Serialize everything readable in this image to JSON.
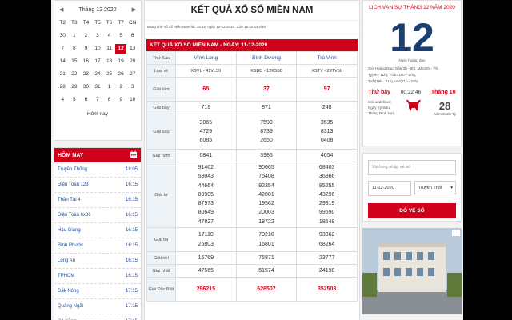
{
  "calendar": {
    "month_label": "Tháng 12 2020",
    "weekdays": [
      "T2",
      "T3",
      "T4",
      "T5",
      "T6",
      "T7",
      "CN"
    ],
    "days": [
      "30",
      "1",
      "2",
      "3",
      "4",
      "5",
      "6",
      "7",
      "8",
      "9",
      "10",
      "11",
      "12",
      "13",
      "14",
      "15",
      "16",
      "17",
      "18",
      "19",
      "20",
      "21",
      "22",
      "23",
      "24",
      "25",
      "26",
      "27",
      "28",
      "29",
      "30",
      "31",
      "1",
      "2",
      "3",
      "4",
      "5",
      "6",
      "7",
      "8",
      "9",
      "10"
    ],
    "selected_day": "12",
    "today_label": "Hôm nay"
  },
  "schedule": {
    "title": "HÔM NAY",
    "rows": [
      {
        "name": "Truyền Thống",
        "time": "18:05"
      },
      {
        "name": "Điện Toán 123",
        "time": "16:15"
      },
      {
        "name": "Thần Tài 4",
        "time": "16:15"
      },
      {
        "name": "Điện Toán 6x36",
        "time": "16:15"
      },
      {
        "name": "Hậu Giang",
        "time": "16:15"
      },
      {
        "name": "Bình Phước",
        "time": "16:15"
      },
      {
        "name": "Long An",
        "time": "16:15"
      },
      {
        "name": "TPHCM",
        "time": "16:15"
      },
      {
        "name": "Đắk Nông",
        "time": "17:15"
      },
      {
        "name": "Quảng Ngãi",
        "time": "17:15"
      },
      {
        "name": "Đà Nẵng",
        "time": "17:15"
      }
    ]
  },
  "results": {
    "page_title": "KẾT QUẢ XỔ SỐ MIỀN NAM",
    "subtitle": "Đang chờ xổ số Miền Nam lúc 16:15' ngày 12-12-2020. Còn 15:52:14 nữa",
    "box_title": "KẾT QUẢ XỔ SỐ MIỀN NAM - NGÀY: 11-12-2020",
    "day_label": "Thứ Sáu",
    "provinces": [
      "Vĩnh Long",
      "Bình Dương",
      "Trà Vinh"
    ],
    "ticket_label": "Loại vé",
    "tickets": [
      "XSVL - 41VL50",
      "XSBD - 12KS50",
      "XSTV - 29TV50"
    ],
    "prizes": [
      {
        "label": "Giải tám",
        "values": [
          [
            "65"
          ],
          [
            "37"
          ],
          [
            "97"
          ]
        ]
      },
      {
        "label": "Giải bảy",
        "values": [
          [
            "719"
          ],
          [
            "871"
          ],
          [
            "248"
          ]
        ]
      },
      {
        "label": "Giải sáu",
        "values": [
          [
            "3865",
            "4729",
            "6085"
          ],
          [
            "7593",
            "8739",
            "2650"
          ],
          [
            "3535",
            "8313",
            "0408"
          ]
        ]
      },
      {
        "label": "Giải năm",
        "values": [
          [
            "0841"
          ],
          [
            "3986"
          ],
          [
            "4654"
          ]
        ]
      },
      {
        "label": "Giải tư",
        "values": [
          [
            "91462",
            "58043",
            "44664",
            "89905",
            "87973",
            "80649",
            "47827"
          ],
          [
            "90665",
            "75408",
            "92354",
            "42801",
            "19562",
            "20003",
            "18722"
          ],
          [
            "68403",
            "36366",
            "85255",
            "43296",
            "29319",
            "99590",
            "18548"
          ]
        ]
      },
      {
        "label": "Giải ba",
        "values": [
          [
            "17110",
            "25803"
          ],
          [
            "79218",
            "16801"
          ],
          [
            "93362",
            "68264"
          ]
        ]
      },
      {
        "label": "Giải nhì",
        "values": [
          [
            "15769"
          ],
          [
            "75871"
          ],
          [
            "23777"
          ]
        ]
      },
      {
        "label": "Giải nhất",
        "values": [
          [
            "47565"
          ],
          [
            "51574"
          ],
          [
            "24198"
          ]
        ]
      },
      {
        "label": "Giải Đặc Biệt",
        "values": [
          [
            "296215"
          ],
          [
            "626507"
          ],
          [
            "352503"
          ]
        ]
      }
    ]
  },
  "lunar": {
    "title": "LỊCH VẠN SỰ THÁNG 12 NĂM 2020",
    "day": "12",
    "good_day": "Ngày hoàng đạo",
    "hours": [
      "Giờ Hoàng Đạo: Dần(3h - 5h), Mão(5h - 7h),",
      "Tỵ(9h - 11h), Thân(15h - 17h),",
      "Tuất(19h - 21h), Hợi(21h - 23h)"
    ],
    "weekday": "Thứ bảy",
    "clock": "00:22:46",
    "lunar_month": "Tháng 10",
    "bl1": "Giờ undefined",
    "bl2": "Ngày Kỷ Sửu",
    "bl3": "Tháng Đinh Hợi",
    "lunar_day": "28",
    "year_label": "Năm Canh Tý"
  },
  "search": {
    "placeholder": "Vui lòng nhập vé số",
    "date": "11-12-2020",
    "station": "Truyền Thối",
    "button": "DÒ VÉ SỐ"
  },
  "colors": {
    "accent": "#d0021b",
    "navy": "#1a3f73",
    "link": "#1a4fa0"
  }
}
